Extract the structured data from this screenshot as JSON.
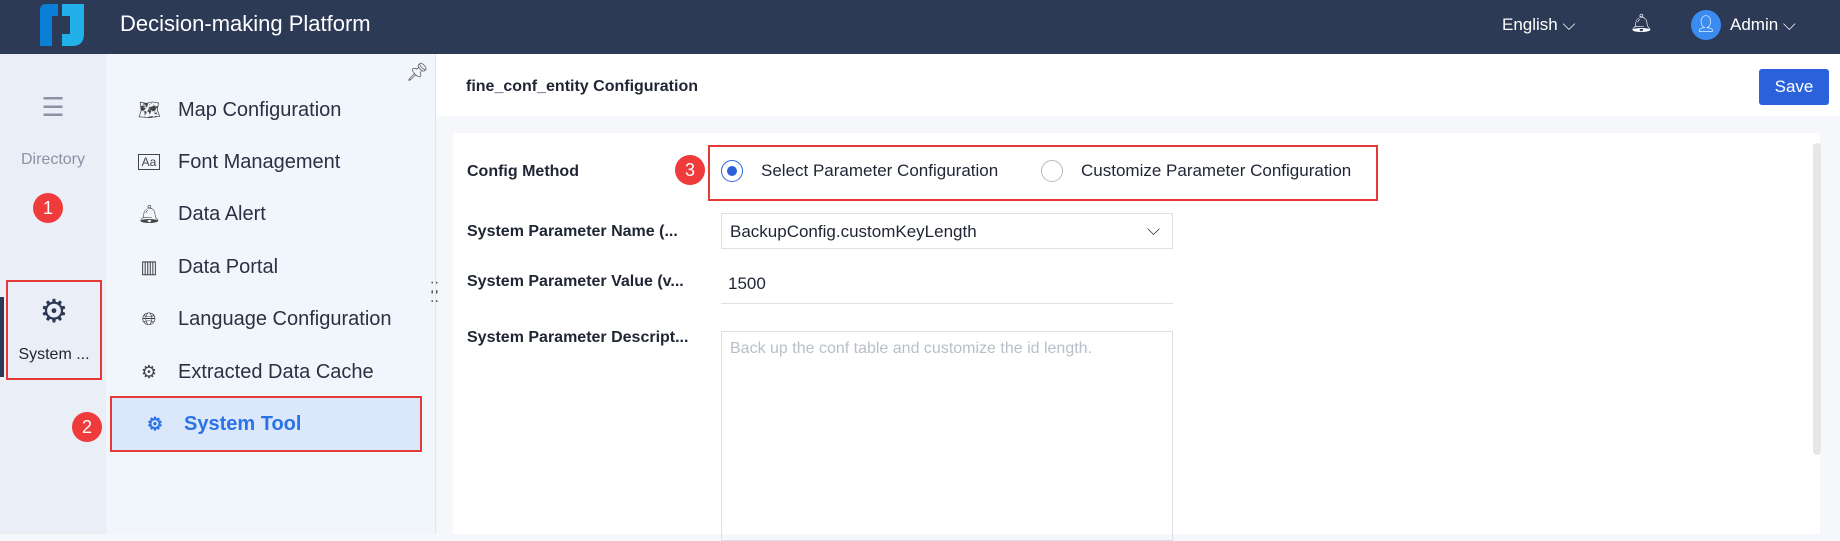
{
  "header": {
    "title": "Decision-making Platform",
    "language": "English",
    "user": "Admin"
  },
  "rail": {
    "items": [
      {
        "label": "Directory",
        "icon": "list-icon"
      },
      {
        "label": "System ...",
        "icon": "gear-icon"
      }
    ]
  },
  "submenu": {
    "items": [
      {
        "label": "Map Configuration",
        "icon": "map-icon"
      },
      {
        "label": "Font Management",
        "icon": "font-icon"
      },
      {
        "label": "Data Alert",
        "icon": "bell-icon"
      },
      {
        "label": "Data Portal",
        "icon": "chart-icon"
      },
      {
        "label": "Language Configuration",
        "icon": "globe-icon"
      },
      {
        "label": "Extracted Data Cache",
        "icon": "gear-icon"
      },
      {
        "label": "System Tool",
        "icon": "gear-tool-icon",
        "active": true
      }
    ]
  },
  "badges": [
    "1",
    "2",
    "3"
  ],
  "page": {
    "title": "fine_conf_entity Configuration",
    "save_label": "Save"
  },
  "form": {
    "config_method_label": "Config Method",
    "options": [
      "Select Parameter Configuration",
      "Customize Parameter Configuration"
    ],
    "selected_option": 0,
    "param_name_label": "System Parameter Name  (...",
    "param_name_value": "BackupConfig.customKeyLength",
    "param_value_label": "System Parameter Value (v...",
    "param_value": "1500",
    "param_desc_label": "System Parameter Descript...",
    "param_desc_placeholder": "Back up the conf table and customize the id length."
  },
  "colors": {
    "header": "#2c3a56",
    "accent": "#2b62dc",
    "highlight": "#e53935"
  }
}
